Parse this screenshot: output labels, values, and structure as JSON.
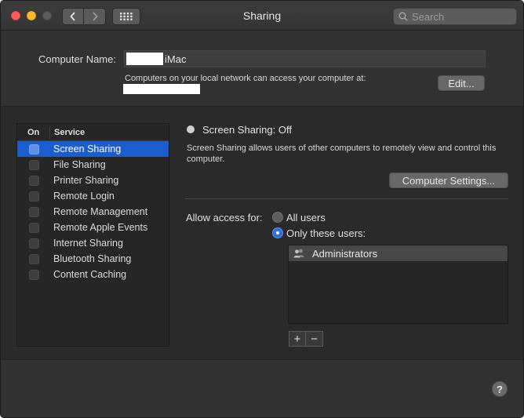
{
  "window": {
    "title": "Sharing",
    "search_placeholder": "Search"
  },
  "computer_name": {
    "label": "Computer Name:",
    "value": "iMac",
    "info": "Computers on your local network can access your computer at:",
    "edit_label": "Edit..."
  },
  "services": {
    "header_on": "On",
    "header_service": "Service",
    "items": [
      {
        "label": "Screen Sharing",
        "checked": false,
        "selected": true
      },
      {
        "label": "File Sharing",
        "checked": false,
        "selected": false
      },
      {
        "label": "Printer Sharing",
        "checked": false,
        "selected": false
      },
      {
        "label": "Remote Login",
        "checked": false,
        "selected": false
      },
      {
        "label": "Remote Management",
        "checked": false,
        "selected": false
      },
      {
        "label": "Remote Apple Events",
        "checked": false,
        "selected": false
      },
      {
        "label": "Internet Sharing",
        "checked": false,
        "selected": false
      },
      {
        "label": "Bluetooth Sharing",
        "checked": false,
        "selected": false
      },
      {
        "label": "Content Caching",
        "checked": false,
        "selected": false
      }
    ]
  },
  "detail": {
    "status": "Screen Sharing: Off",
    "description": "Screen Sharing allows users of other computers to remotely view and control this computer.",
    "computer_settings_label": "Computer Settings...",
    "allow_access_label": "Allow access for:",
    "option_all_users": "All users",
    "option_only_these": "Only these users:",
    "selected_option": "only_these",
    "users": [
      "Administrators"
    ],
    "add_label": "+",
    "remove_label": "−"
  },
  "help_label": "?",
  "colors": {
    "accent": "#1b5dcf",
    "window_bg": "#323232",
    "panel_bg": "#2a2a2a"
  }
}
